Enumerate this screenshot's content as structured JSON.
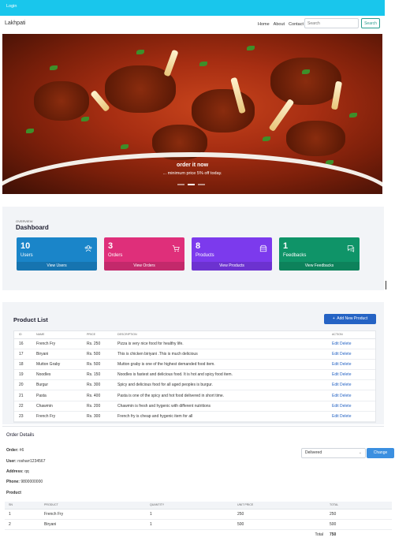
{
  "topbar": {
    "login": "Login"
  },
  "navbar": {
    "brand": "Lakhpati",
    "links": [
      "Home",
      "About",
      "Contact"
    ],
    "search_placeholder": "Search",
    "search_button": "Search"
  },
  "hero": {
    "title": "order it now",
    "subtitle": "... minimum price 5% off today."
  },
  "dashboard": {
    "overview_label": "OVERVIEW",
    "title": "Dashboard",
    "cards": [
      {
        "count": "10",
        "label": "Users",
        "link": "View Users",
        "color": "#1a85c9",
        "icon": "users-icon"
      },
      {
        "count": "3",
        "label": "Orders",
        "link": "View Orders",
        "color": "#df2f7a",
        "icon": "cart-icon"
      },
      {
        "count": "8",
        "label": "Products",
        "link": "View Products",
        "color": "#7c3aed",
        "icon": "box-icon"
      },
      {
        "count": "1",
        "label": "Feedbacks",
        "link": "View Feedbacks",
        "color": "#0f9468",
        "icon": "chat-icon"
      }
    ]
  },
  "product_list": {
    "title": "Product List",
    "add_button": "Add New Product",
    "headers": [
      "ID",
      "NAME",
      "PRICE",
      "DESCRIPTION",
      "ACTION"
    ],
    "rows": [
      {
        "id": "16",
        "name": "French Fry",
        "price": "Rs. 250",
        "description": "Pizza is very nice food for healthy life."
      },
      {
        "id": "17",
        "name": "Biryani",
        "price": "Rs. 500",
        "description": "This is chicken biriyani .This is much delicious"
      },
      {
        "id": "18",
        "name": "Mutton Graby",
        "price": "Rs. 500",
        "description": "Mutton graby is one of the highest demanded food item."
      },
      {
        "id": "19",
        "name": "Noodles",
        "price": "Rs. 150",
        "description": "Noodles is fastest and delicious food. It is hot and spicy food item."
      },
      {
        "id": "20",
        "name": "Burgur",
        "price": "Rs. 300",
        "description": "Spicy and delicious food for all aged peoples is burgur."
      },
      {
        "id": "21",
        "name": "Pasta",
        "price": "Rs. 400",
        "description": "Pasta is one of the spicy and hot food delivered in short time."
      },
      {
        "id": "22",
        "name": "Chawmin",
        "price": "Rs. 200",
        "description": "Chawmin is fresh and hygenic with different nutritions"
      },
      {
        "id": "23",
        "name": "French Fry",
        "price": "Rs. 300",
        "description": "French fry is cheap and hygenic item for all"
      }
    ],
    "edit_label": "Edit",
    "delete_label": "Delete"
  },
  "order_details": {
    "title": "Order Details",
    "order_label": "Order:",
    "order_value": "#6",
    "user_label": "User:",
    "user_value": "rosharr1234567",
    "address_label": "Address:",
    "address_value": "qq",
    "phone_label": "Phone:",
    "phone_value": "9800000000",
    "product_label": "Product",
    "status_value": "Delivered",
    "change_button": "Change",
    "headers": [
      "SN",
      "PRODUCT",
      "QUANTITY",
      "UNIT PRICE",
      "TOTAL"
    ],
    "rows": [
      {
        "sn": "1",
        "product": "French Fry",
        "quantity": "1",
        "unit_price": "250",
        "total": "250"
      },
      {
        "sn": "2",
        "product": "Biryani",
        "quantity": "1",
        "unit_price": "500",
        "total": "500"
      }
    ],
    "total_label": "Total",
    "total_value": "750"
  }
}
